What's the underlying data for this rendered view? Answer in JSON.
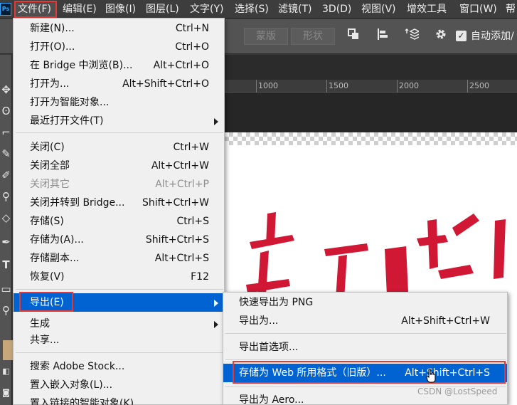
{
  "app": {
    "logo": "Ps"
  },
  "menubar": {
    "items": [
      "文件(F)",
      "编辑(E)",
      "图像(I)",
      "图层(L)",
      "文字(Y)",
      "选择(S)",
      "滤镜(T)",
      "3D(D)",
      "视图(V)",
      "增效工具",
      "窗口(W)",
      "帮"
    ]
  },
  "options_bar": {
    "mask_button": "蒙版",
    "shape_button": "形状",
    "auto_add_label": "自动添加/",
    "auto_add_checked": true
  },
  "ruler": {
    "marks": [
      "1000",
      "1500",
      "2000",
      "2500"
    ]
  },
  "file_menu": {
    "items": [
      {
        "label": "新建(N)...",
        "shortcut": "Ctrl+N"
      },
      {
        "label": "打开(O)...",
        "shortcut": "Ctrl+O"
      },
      {
        "label": "在 Bridge 中浏览(B)...",
        "shortcut": "Alt+Ctrl+O"
      },
      {
        "label": "打开为...",
        "shortcut": "Alt+Shift+Ctrl+O"
      },
      {
        "label": "打开为智能对象...",
        "shortcut": ""
      },
      {
        "label": "最近打开文件(T)",
        "shortcut": "",
        "submenu": true
      },
      {
        "label": "关闭(C)",
        "shortcut": "Ctrl+W"
      },
      {
        "label": "关闭全部",
        "shortcut": "Alt+Ctrl+W"
      },
      {
        "label": "关闭其它",
        "shortcut": "Alt+Ctrl+P",
        "disabled": true
      },
      {
        "label": "关闭并转到 Bridge...",
        "shortcut": "Shift+Ctrl+W"
      },
      {
        "label": "存储(S)",
        "shortcut": "Ctrl+S"
      },
      {
        "label": "存储为(A)...",
        "shortcut": "Shift+Ctrl+S"
      },
      {
        "label": "存储副本...",
        "shortcut": "Alt+Ctrl+S"
      },
      {
        "label": "恢复(V)",
        "shortcut": "F12"
      },
      {
        "label": "导出(E)",
        "shortcut": "",
        "submenu": true,
        "active": true
      },
      {
        "label": "生成",
        "shortcut": "",
        "submenu": true
      },
      {
        "label": "共享...",
        "shortcut": ""
      },
      {
        "label": "搜索 Adobe Stock...",
        "shortcut": ""
      },
      {
        "label": "置入嵌入对象(L)...",
        "shortcut": ""
      },
      {
        "label": "置入链接的智能对象(K)...",
        "shortcut": ""
      }
    ]
  },
  "export_menu": {
    "items": [
      {
        "label": "快速导出为 PNG",
        "shortcut": ""
      },
      {
        "label": "导出为...",
        "shortcut": "Alt+Shift+Ctrl+W"
      },
      {
        "label": "导出首选项...",
        "shortcut": ""
      },
      {
        "label": "存储为 Web 所用格式（旧版）...",
        "shortcut": "Alt+Shift+Ctrl+S",
        "active": true
      },
      {
        "label": "导出为 Aero...",
        "shortcut": ""
      }
    ]
  },
  "watermark": "CSDN @LostSpeed",
  "colors": {
    "highlight": "#0063d1",
    "annotation": "#e53935",
    "menu_bg": "#f0f0f0",
    "calligraphy": "#d01835"
  }
}
